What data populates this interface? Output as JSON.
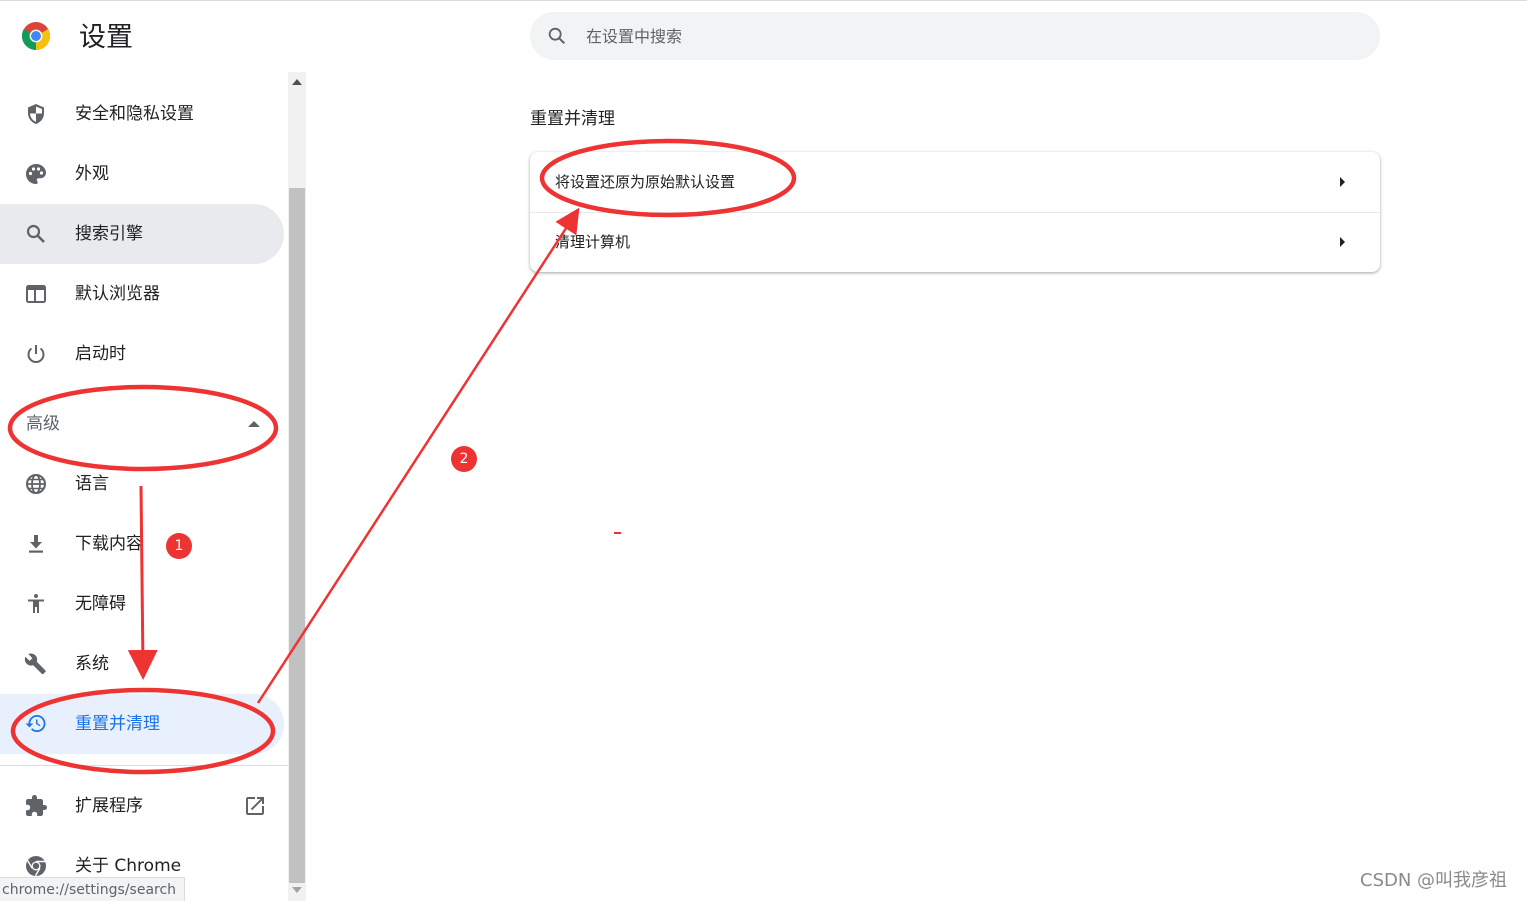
{
  "header": {
    "title": "设置",
    "search_placeholder": "在设置中搜索"
  },
  "sidebar": {
    "items": [
      {
        "label": "安全和隐私设置",
        "icon": "shield-icon"
      },
      {
        "label": "外观",
        "icon": "palette-icon"
      },
      {
        "label": "搜索引擎",
        "icon": "search-icon"
      },
      {
        "label": "默认浏览器",
        "icon": "browser-window-icon"
      },
      {
        "label": "启动时",
        "icon": "power-icon"
      }
    ],
    "advanced_label": "高级",
    "advanced_items": [
      {
        "label": "语言",
        "icon": "globe-icon"
      },
      {
        "label": "下载内容",
        "icon": "download-icon"
      },
      {
        "label": "无障碍",
        "icon": "accessibility-icon"
      },
      {
        "label": "系统",
        "icon": "wrench-icon"
      },
      {
        "label": "重置并清理",
        "icon": "restore-icon"
      }
    ],
    "bottom_items": [
      {
        "label": "扩展程序",
        "icon": "puzzle-icon"
      },
      {
        "label": "关于 Chrome",
        "icon": "chrome-icon"
      }
    ]
  },
  "status_url": "chrome://settings/search",
  "main": {
    "section_title": "重置并清理",
    "rows": [
      {
        "label": "将设置还原为原始默认设置"
      },
      {
        "label": "清理计算机"
      }
    ]
  },
  "annotations": {
    "badge_1": "1",
    "badge_2": "2",
    "color": "#ee3333"
  },
  "watermark": "CSDN @叫我彦祖",
  "colors": {
    "accent": "#1a73e8",
    "active_bg": "#e8f0fe",
    "hover_bg": "#e8eaed"
  }
}
